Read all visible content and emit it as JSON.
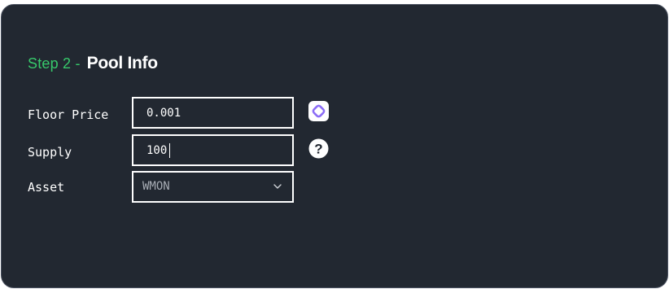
{
  "heading": {
    "step": "Step 2 -",
    "title": "Pool Info"
  },
  "fields": {
    "floor_price": {
      "label": "Floor Price",
      "value": "0.001",
      "icon": "token-logo-icon"
    },
    "supply": {
      "label": "Supply",
      "value": "100",
      "icon": "help-icon"
    },
    "asset": {
      "label": "Asset",
      "value": "WMON",
      "icon": "chevron-down-icon"
    }
  },
  "colors": {
    "card_background": "#222831",
    "step_accent": "#37c96b",
    "token_icon": "#8b6cf6",
    "text": "#ffffff",
    "muted_text": "#a7acb4"
  }
}
